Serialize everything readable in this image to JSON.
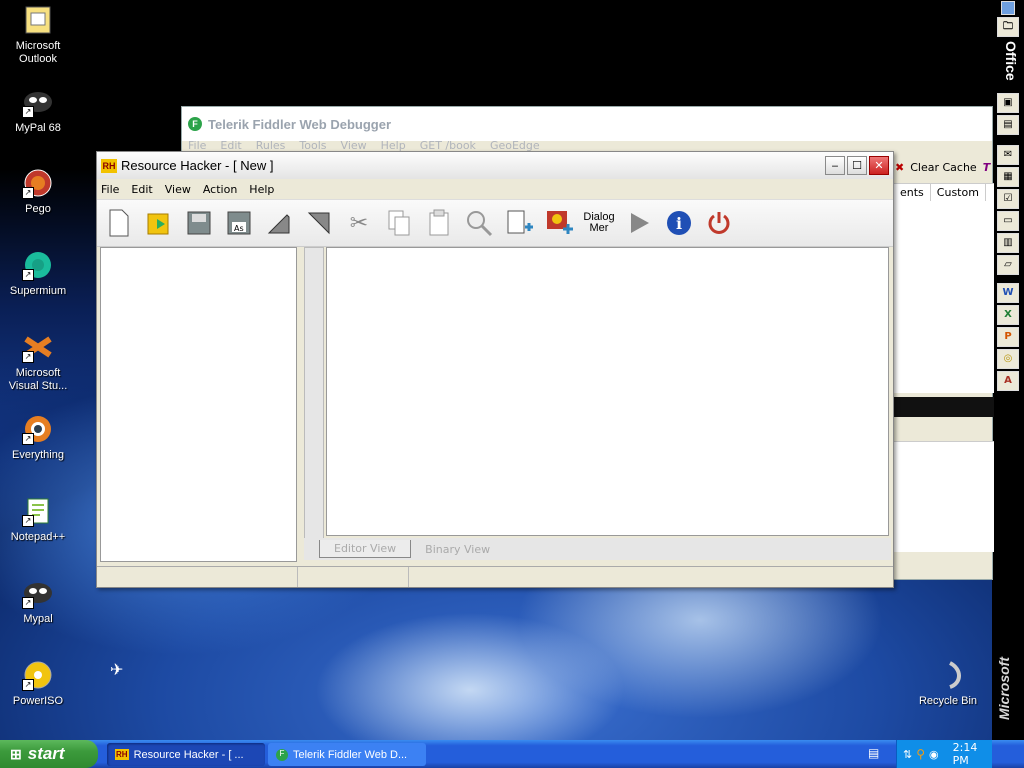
{
  "desktop": {
    "icons": [
      {
        "label": "Microsoft Outlook"
      },
      {
        "label": "MyPal 68"
      },
      {
        "label": "Pego"
      },
      {
        "label": "Supermium"
      },
      {
        "label": "Microsoft Visual Stu..."
      },
      {
        "label": "Everything"
      },
      {
        "label": "Notepad++"
      },
      {
        "label": "Mypal"
      },
      {
        "label": "PowerISO"
      },
      {
        "label": "Recycle Bin"
      }
    ]
  },
  "office_bar": {
    "title": "Office",
    "brand": "Microsoft"
  },
  "fiddler": {
    "title": "Telerik Fiddler Web Debugger",
    "menu": [
      "File",
      "Edit",
      "Rules",
      "Tools",
      "View",
      "Help",
      "GET /book",
      "GeoEdge"
    ],
    "clear_cache": "Clear Cache",
    "columns": [
      "ents",
      "Custom"
    ]
  },
  "resource_hacker": {
    "title": "Resource Hacker - [ New ]",
    "menu": [
      "File",
      "Edit",
      "View",
      "Action",
      "Help"
    ],
    "toolbar": {
      "dialog_line1": "Dialog",
      "dialog_line2": "Mer"
    },
    "tabs": [
      "Editor View",
      "Binary View"
    ]
  },
  "taskbar": {
    "start_label": "start",
    "buttons": [
      {
        "label": "Resource Hacker - [ ...",
        "active": true
      },
      {
        "label": "Telerik Fiddler Web D...",
        "active": false
      }
    ],
    "clock": "2:14 PM"
  },
  "colors": {
    "taskbar": "#245edb",
    "start": "#3c9a3c",
    "close_button": "#c22"
  }
}
